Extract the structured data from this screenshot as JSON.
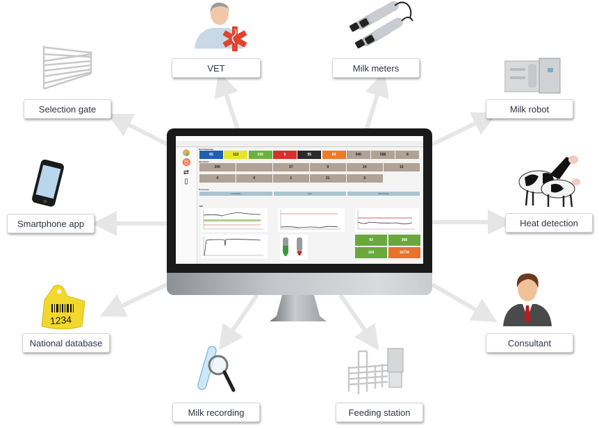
{
  "nodes": {
    "vet": {
      "label": "VET",
      "icon": "veterinarian-icon"
    },
    "milk_meters": {
      "label": "Milk meters",
      "icon": "milk-meters-icon"
    },
    "selection_gate": {
      "label": "Selection gate",
      "icon": "selection-gate-icon"
    },
    "milk_robot": {
      "label": "Milk robot",
      "icon": "milk-robot-icon"
    },
    "smartphone_app": {
      "label": "Smartphone app",
      "icon": "smartphone-icon"
    },
    "heat_detection": {
      "label": "Heat detection",
      "icon": "cows-icon"
    },
    "national_database": {
      "label": "National database",
      "icon": "ear-tag-icon",
      "tag_number": "1234"
    },
    "consultant": {
      "label": "Consultant",
      "icon": "consultant-icon"
    },
    "milk_recording": {
      "label": "Milk recording",
      "icon": "test-tube-magnifier-icon"
    },
    "feeding_station": {
      "label": "Feeding station",
      "icon": "feeding-station-icon"
    }
  },
  "colors": {
    "arrow": "#e6e6e6",
    "label_text": "#2f3440",
    "tile_blue": "#1f5fb4",
    "tile_yellow": "#e6e62a",
    "tile_green": "#6bb33a",
    "tile_red": "#d9302b",
    "tile_dark": "#2b2b2b",
    "tile_orange": "#ee7a2a",
    "tile_brown": "#b0a294",
    "process_blue": "#a9c3cf",
    "kpi_green": "#6aa83c",
    "kpi_orange": "#e9722a"
  },
  "screen": {
    "sections": {
      "herd_summary": "Herd Summary",
      "attentions": "Attentions",
      "processes": "Processes",
      "kpi": "KPI"
    },
    "herd_tiles": [
      {
        "value": "65",
        "color": "#1f5fb4"
      },
      {
        "value": "113",
        "color": "#e6e62a"
      },
      {
        "value": "243",
        "color": "#6bb33a"
      },
      {
        "value": "5",
        "color": "#d9302b"
      },
      {
        "value": "55",
        "color": "#2b2b2b"
      },
      {
        "value": "63",
        "color": "#ee7a2a"
      },
      {
        "value": "540",
        "color": "#b0a294"
      },
      {
        "value": "588",
        "color": "#b0a294"
      },
      {
        "value": "8",
        "color": "#b0a294"
      }
    ],
    "attention_tiles_row1": [
      {
        "value": "206"
      },
      {
        "value": ""
      },
      {
        "value": "37"
      },
      {
        "value": "9"
      },
      {
        "value": "14"
      },
      {
        "value": "10"
      }
    ],
    "attention_tiles_row2": [
      {
        "value": "4"
      },
      {
        "value": "0"
      },
      {
        "value": "1"
      },
      {
        "value": "21"
      },
      {
        "value": "6"
      }
    ],
    "processes": [
      "Insemination",
      "Feed",
      "External links"
    ],
    "kpi_tiles": [
      {
        "value": "93",
        "color": "#6aa83c"
      },
      {
        "value": "366",
        "color": "#6aa83c"
      },
      {
        "value": "164",
        "color": "#6aa83c"
      },
      {
        "value": "16734",
        "color": "#e9722a"
      }
    ]
  }
}
